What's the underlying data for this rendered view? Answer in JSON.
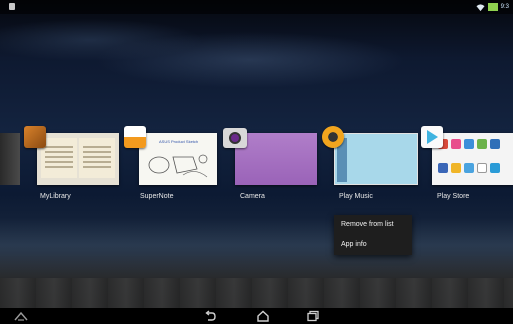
{
  "status_bar": {
    "time": "9:3",
    "icons": [
      "notification-icon",
      "wifi-icon",
      "battery-icon"
    ],
    "battery_color": "#8fd14f"
  },
  "recent_apps": [
    {
      "label": "MyLibrary",
      "icon": "mylibrary-icon"
    },
    {
      "label": "SuperNote",
      "icon": "supernote-icon",
      "thumbnail_heading": "ASUS Product Sketch"
    },
    {
      "label": "Camera",
      "icon": "camera-icon"
    },
    {
      "label": "Play Music",
      "icon": "play-music-icon"
    },
    {
      "label": "Play Store",
      "icon": "play-store-icon"
    }
  ],
  "context_menu": {
    "items": [
      "Remove from list",
      "App info"
    ]
  },
  "nav_bar": {
    "buttons": [
      "asus-menu-icon",
      "back-icon",
      "home-icon",
      "recent-apps-icon"
    ]
  }
}
